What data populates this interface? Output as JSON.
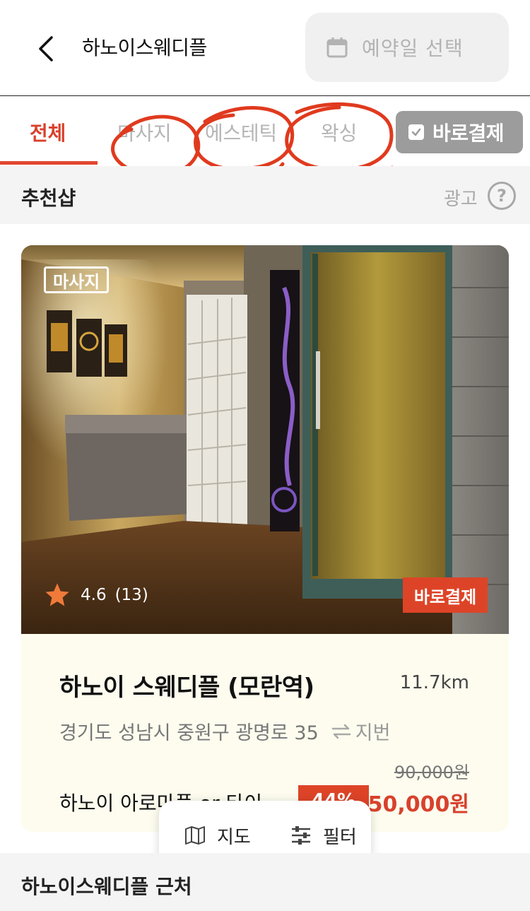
{
  "header": {
    "title": "하노이스웨디플",
    "date_placeholder": "예약일 선택"
  },
  "tabs": [
    {
      "label": "전체",
      "active": true
    },
    {
      "label": "마사지",
      "active": false
    },
    {
      "label": "에스테틱",
      "active": false
    },
    {
      "label": "왁싱",
      "active": false
    }
  ],
  "instant_pay_filter": {
    "label": "바로결제",
    "checked": true
  },
  "recommended": {
    "title": "추천샵",
    "ad_label": "광고",
    "help_glyph": "?"
  },
  "card": {
    "category_badge": "마사지",
    "rating": "4.6",
    "review_count": "(13)",
    "pay_badge": "바로결제",
    "name": "하노이 스웨디플 (모란역)",
    "distance": "11.7km",
    "address": "경기도 성남시 중원구 광명로 35",
    "jibun_label": "지번",
    "original_price": "90,000원",
    "product": "하노이 아로마플 or 타이...",
    "discount": "44%",
    "price": "50,000원"
  },
  "float_bar": {
    "map_label": "지도",
    "filter_label": "필터"
  },
  "nearby": {
    "title": "하노이스웨디플 근처"
  },
  "colors": {
    "accent": "#e2472e",
    "badge_red": "#dd4427",
    "card_bg": "#fdfcee",
    "section_bg": "#f4f4f4",
    "scribble": "#e03a1e"
  },
  "icons": [
    "back-chevron-icon",
    "calendar-icon",
    "checkbox-icon",
    "help-icon",
    "star-icon",
    "swap-arrows-icon",
    "map-icon",
    "filter-sliders-icon"
  ]
}
